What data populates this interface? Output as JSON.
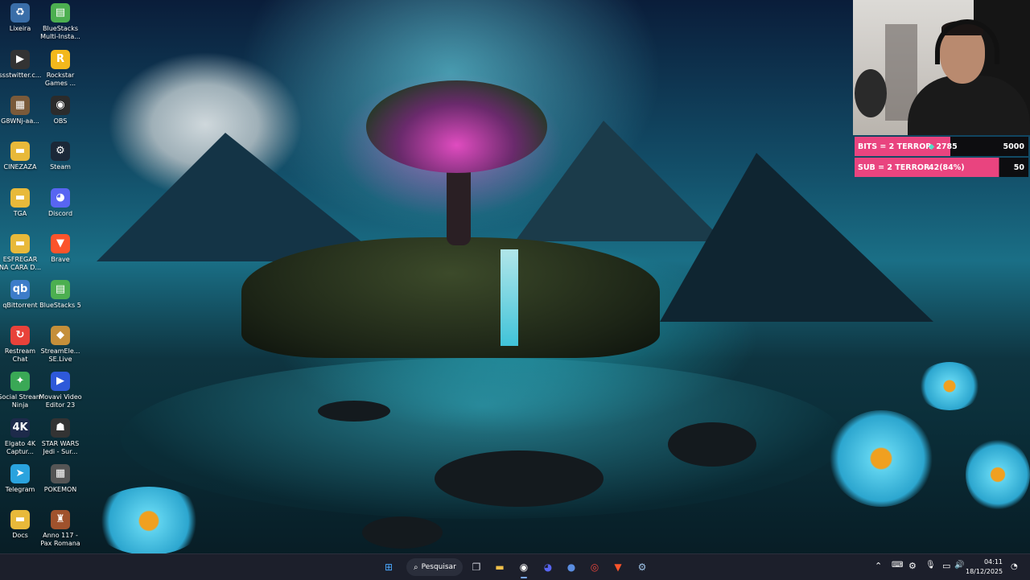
{
  "desktop": {
    "icons_col1": [
      {
        "label": "Lixeira",
        "icon": "recycle-bin-icon",
        "glyph": "♻",
        "color": "#3a6ea8"
      },
      {
        "label": "ssstwitter.c...",
        "icon": "video-file-icon",
        "glyph": "▶",
        "color": "#333"
      },
      {
        "label": "G8WNj-aa...",
        "icon": "image-file-icon",
        "glyph": "▦",
        "color": "#7a5a3a"
      },
      {
        "label": "CINEZAZA",
        "icon": "folder-icon",
        "glyph": "▬",
        "color": "#e8b93a"
      },
      {
        "label": "TGA",
        "icon": "folder-icon",
        "glyph": "▬",
        "color": "#e8b93a"
      },
      {
        "label": "ESFREGAR NA CARA D...",
        "icon": "folder-icon",
        "glyph": "▬",
        "color": "#e8b93a"
      },
      {
        "label": "qBittorrent",
        "icon": "qbittorrent-icon",
        "glyph": "qb",
        "color": "#3d7cc9"
      },
      {
        "label": "Restream Chat",
        "icon": "restream-icon",
        "glyph": "↻",
        "color": "#e8423a"
      },
      {
        "label": "Social Stream Ninja",
        "icon": "social-stream-icon",
        "glyph": "✦",
        "color": "#3aa856"
      },
      {
        "label": "Elgato 4K Captur...",
        "icon": "elgato-icon",
        "glyph": "4K",
        "color": "#1d2a4a"
      },
      {
        "label": "Telegram",
        "icon": "telegram-icon",
        "glyph": "➤",
        "color": "#2aa3de"
      },
      {
        "label": "Docs",
        "icon": "folder-icon",
        "glyph": "▬",
        "color": "#e8b93a"
      }
    ],
    "icons_col2": [
      {
        "label": "BlueStacks Multi-Insta...",
        "icon": "bluestacks-icon",
        "glyph": "▤",
        "color": "#4caf50"
      },
      {
        "label": "Rockstar Games ...",
        "icon": "rockstar-icon",
        "glyph": "R",
        "color": "#f3b81c"
      },
      {
        "label": "OBS",
        "icon": "obs-icon",
        "glyph": "◉",
        "color": "#2b2b2b"
      },
      {
        "label": "Steam",
        "icon": "steam-icon",
        "glyph": "⚙",
        "color": "#1b2838"
      },
      {
        "label": "Discord",
        "icon": "discord-icon",
        "glyph": "◕",
        "color": "#5865f2"
      },
      {
        "label": "Brave",
        "icon": "brave-icon",
        "glyph": "▼",
        "color": "#fb542b"
      },
      {
        "label": "BlueStacks 5",
        "icon": "bluestacks-icon",
        "glyph": "▤",
        "color": "#4caf50"
      },
      {
        "label": "StreamEle... SE.Live",
        "icon": "streamelements-icon",
        "glyph": "◆",
        "color": "#c58f3a"
      },
      {
        "label": "Movavi Video Editor 23",
        "icon": "movavi-icon",
        "glyph": "▶",
        "color": "#2e59d9"
      },
      {
        "label": "STAR WARS Jedi - Sur...",
        "icon": "star-wars-icon",
        "glyph": "☗",
        "color": "#333"
      },
      {
        "label": "POKEMON",
        "icon": "pokemon-icon",
        "glyph": "▦",
        "color": "#555"
      },
      {
        "label": "Anno 117 - Pax Romana",
        "icon": "anno-icon",
        "glyph": "♜",
        "color": "#a0522d"
      }
    ]
  },
  "overlay": {
    "bits_goal": {
      "label": "BITS = 2 TERROR",
      "current": "2785",
      "target": "5000",
      "progress": 0.557
    },
    "sub_goal": {
      "label": "SUB = 2 TERROR",
      "current": "42(84%)",
      "target": "50",
      "progress": 0.84
    }
  },
  "taskbar": {
    "search_label": "Pesquisar",
    "apps": [
      {
        "name": "start-button",
        "glyph": "⊞",
        "color": "#4aa8ff"
      },
      {
        "name": "task-view-icon",
        "glyph": "❐",
        "color": "#cfd3dc"
      },
      {
        "name": "file-explorer-icon",
        "glyph": "▬",
        "color": "#f2c04a"
      },
      {
        "name": "obs-taskbar-icon",
        "glyph": "◉",
        "color": "#ffffff"
      },
      {
        "name": "discord-taskbar-icon",
        "glyph": "◕",
        "color": "#5865f2"
      },
      {
        "name": "app-taskbar-icon",
        "glyph": "●",
        "color": "#5a8de0"
      },
      {
        "name": "chrome-taskbar-icon",
        "glyph": "◎",
        "color": "#e8453c"
      },
      {
        "name": "brave-taskbar-icon",
        "glyph": "▼",
        "color": "#fb542b"
      },
      {
        "name": "steam-taskbar-icon",
        "glyph": "⚙",
        "color": "#9fc4e8"
      }
    ],
    "tray": {
      "chevron": "⌃",
      "keyboard": "⌨",
      "steam": "⚙",
      "mic": "🎙",
      "network": "▭",
      "volume": "🔊",
      "time": "04:11",
      "date": "18/12/2025",
      "notification": "◔"
    }
  }
}
